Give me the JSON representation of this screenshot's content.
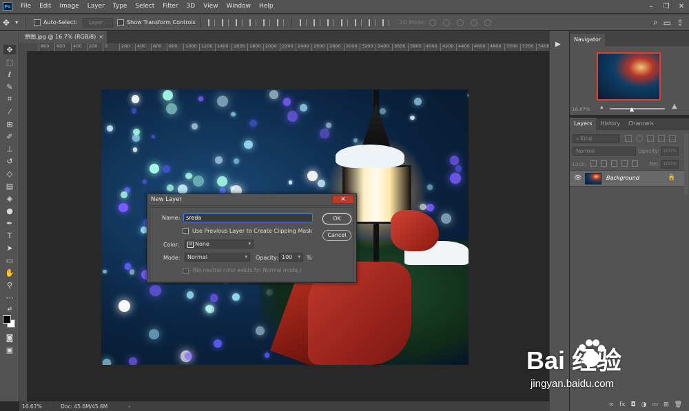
{
  "menubar": {
    "logo": "Ps",
    "items": [
      "File",
      "Edit",
      "Image",
      "Layer",
      "Type",
      "Select",
      "Filter",
      "3D",
      "View",
      "Window",
      "Help"
    ],
    "window_controls": [
      "–",
      "❐",
      "✕"
    ]
  },
  "options": {
    "auto_select_label": "Auto-Select:",
    "auto_select_value": "Layer",
    "show_transform_label": "Show Transform Controls",
    "mode_3d_label": "3D Mode:"
  },
  "document_tab": {
    "title": "原图.jpg @ 16.7% (RGB/8)",
    "close": "×"
  },
  "ruler": {
    "ticks": [
      "800",
      "600",
      "400",
      "200",
      "0",
      "200",
      "400",
      "600",
      "800",
      "1000",
      "1200",
      "1400",
      "1600",
      "1800",
      "2000",
      "2200",
      "2400",
      "2600",
      "2800",
      "3000",
      "3200",
      "3400",
      "3600",
      "3800",
      "4000",
      "4200",
      "4400",
      "4600",
      "4800",
      "5000",
      "5200",
      "5400"
    ]
  },
  "dialog": {
    "title": "New Layer",
    "name_label": "Name:",
    "name_value": "sreda",
    "clipping_label": "Use Previous Layer to Create Clipping Mask",
    "color_label": "Color:",
    "color_value": "None",
    "mode_label": "Mode:",
    "mode_value": "Normal",
    "opacity_label": "Opacity:",
    "opacity_value": "100",
    "opacity_unit": "%",
    "neutral_note": "(No neutral color exists for Normal mode.)",
    "ok": "OK",
    "cancel": "Cancel"
  },
  "status": {
    "zoom": "16.67%",
    "doc": "Doc: 45.6M/45.6M",
    "arrow": "›"
  },
  "navigator": {
    "title": "Navigator",
    "zoom": "16.67%"
  },
  "layers_panel": {
    "tabs": [
      "Layers",
      "History",
      "Channels"
    ],
    "kind_label": "Kind",
    "blend_mode": "Normal",
    "opacity_label": "Opacity:",
    "opacity_value": "100%",
    "lock_label": "Lock:",
    "fill_label": "Fill:",
    "fill_value": "100%",
    "layers": [
      {
        "name": "Background",
        "visible": true,
        "locked": true
      }
    ],
    "footer_icons": [
      "link-icon",
      "fx-icon",
      "mask-icon",
      "adjustment-icon",
      "group-icon",
      "new-layer-icon",
      "trash-icon"
    ]
  },
  "watermark": {
    "brand": "Bai  经验",
    "url": "jingyan.baidu.com"
  },
  "colors": {
    "ui_dark": "#535353",
    "canvas_bg": "#282828",
    "accent_blue": "#31a8ff",
    "nav_frame": "#e33b2e"
  }
}
